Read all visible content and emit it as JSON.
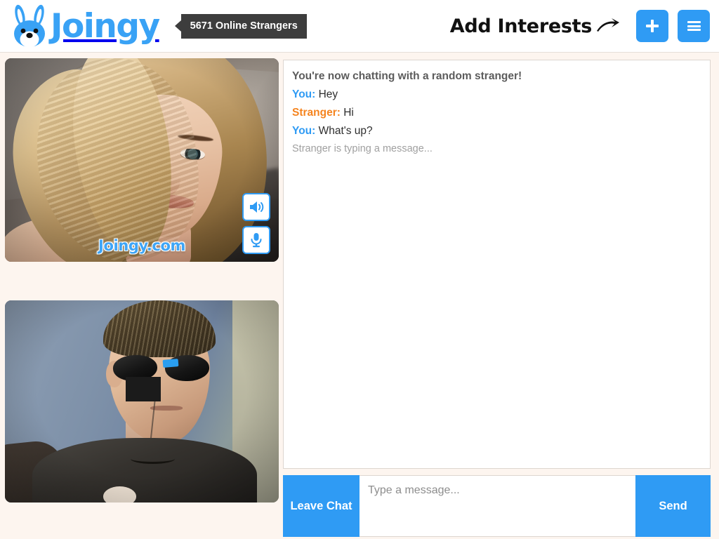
{
  "header": {
    "logo_text": "Joingy",
    "logo_icon": "bunny-icon",
    "online_count_label": "5671 Online Strangers",
    "add_interests_label": "Add Interests",
    "arrow_icon": "curved-arrow-icon",
    "add_button_icon": "plus-icon",
    "menu_button_icon": "hamburger-menu-icon",
    "accent_color": "#2f9bf4",
    "badge_color": "#3d3d3d"
  },
  "video": {
    "stranger": {
      "label": "stranger-video",
      "watermark": "Joingy.com",
      "controls": [
        {
          "name": "speaker-icon",
          "label": "Volume"
        },
        {
          "name": "microphone-icon",
          "label": "Microphone"
        }
      ]
    },
    "self": {
      "label": "self-video"
    }
  },
  "chat": {
    "system_message": "You're now chatting with a random stranger!",
    "messages": [
      {
        "who": "You:",
        "role": "you",
        "text": "Hey"
      },
      {
        "who": "Stranger:",
        "role": "stranger",
        "text": "Hi"
      },
      {
        "who": "You:",
        "role": "you",
        "text": "What's up?"
      }
    ],
    "typing_status": "Stranger is typing a message...",
    "you_color": "#2f9bf4",
    "stranger_color": "#f5841f"
  },
  "composer": {
    "leave_label": "Leave Chat",
    "input_value": "",
    "input_placeholder": "Type a message...",
    "send_label": "Send"
  }
}
